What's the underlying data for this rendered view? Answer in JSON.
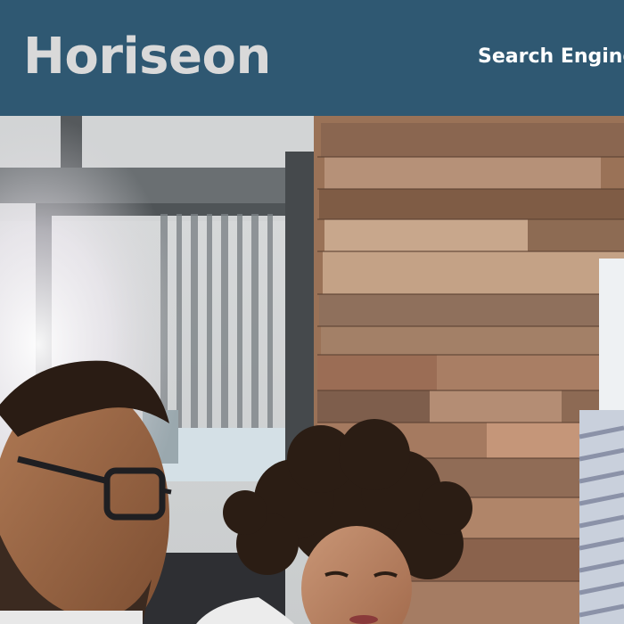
{
  "header": {
    "brand": "Horiseon",
    "background_color": "#2f5872",
    "nav": [
      {
        "label": "Search Engine Optimization"
      }
    ]
  },
  "hero": {
    "description_icon": "photo-people-working"
  }
}
